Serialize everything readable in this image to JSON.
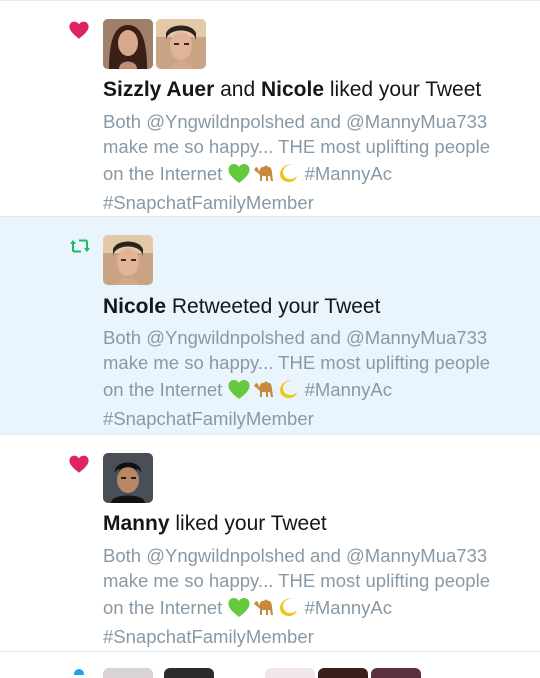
{
  "notifications": [
    {
      "type": "like",
      "icon": "heart-icon",
      "user1": "Sizzly Auer",
      "connector": "and",
      "user2": "Nicole",
      "action": "liked your Tweet",
      "tweet": {
        "line1": "Both @Yngwildnpolshed and @MannyMua733",
        "line2": "make me so happy... THE most uplifting people",
        "line3": "on the Internet",
        "hashtag1": "#MannyAc",
        "line4": "#SnapchatFamilyMember",
        "emojis": [
          "green-heart",
          "camel",
          "crescent-moon"
        ]
      }
    },
    {
      "type": "retweet",
      "icon": "retweet-icon",
      "user1": "Nicole",
      "action": "Retweeted your Tweet",
      "tweet": {
        "line1": "Both @Yngwildnpolshed and @MannyMua733",
        "line2": "make me so happy... THE most uplifting people",
        "line3": "on the Internet",
        "hashtag1": "#MannyAc",
        "line4": "#SnapchatFamilyMember",
        "emojis": [
          "green-heart",
          "camel",
          "crescent-moon"
        ]
      }
    },
    {
      "type": "like",
      "icon": "heart-icon",
      "user1": "Manny",
      "action": "liked your Tweet",
      "tweet": {
        "line1": "Both @Yngwildnpolshed and @MannyMua733",
        "line2": "make me so happy... THE most uplifting people",
        "line3": "on the Internet",
        "hashtag1": "#MannyAc",
        "line4": "#SnapchatFamilyMember",
        "emojis": [
          "green-heart",
          "camel",
          "crescent-moon"
        ]
      }
    }
  ],
  "colors": {
    "like": "#e0245e",
    "retweet": "#17bf63",
    "secondary_text": "#8899a6",
    "highlight_bg": "#eaf4fd"
  }
}
